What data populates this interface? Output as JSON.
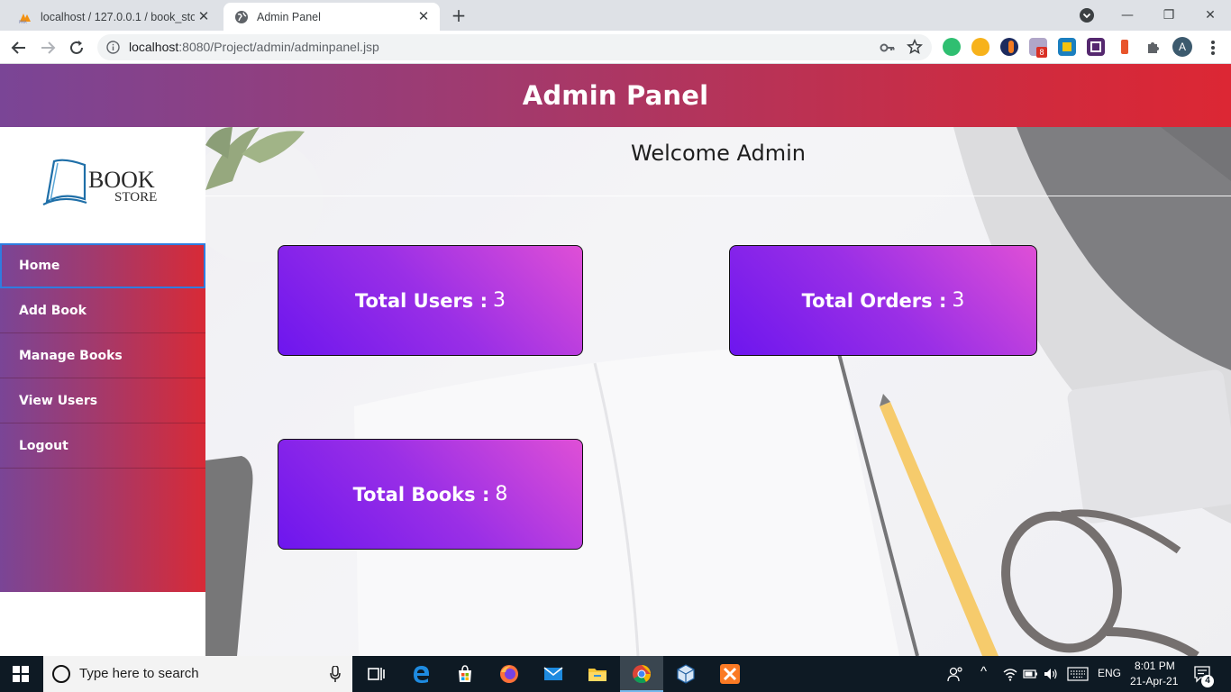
{
  "browser": {
    "tabs": [
      {
        "title": "localhost / 127.0.0.1 / book_store",
        "active": false
      },
      {
        "title": "Admin Panel",
        "active": true
      }
    ],
    "url_host": "localhost",
    "url_rest": ":8080/Project/admin/adminpanel.jsp",
    "profile_initial": "A",
    "extension_badge": "8"
  },
  "page": {
    "header_title": "Admin Panel",
    "welcome": "Welcome Admin",
    "logo": {
      "line1": "BOOK",
      "line2": "STORE"
    },
    "menu": [
      {
        "label": "Home",
        "active": true
      },
      {
        "label": "Add Book",
        "active": false
      },
      {
        "label": "Manage Books",
        "active": false
      },
      {
        "label": "View Users",
        "active": false
      },
      {
        "label": "Logout",
        "active": false
      }
    ],
    "cards": {
      "users": {
        "label": "Total Users :",
        "value": "3"
      },
      "orders": {
        "label": "Total Orders :",
        "value": "3"
      },
      "books": {
        "label": "Total Books :",
        "value": "8"
      }
    }
  },
  "taskbar": {
    "search_placeholder": "Type here to search",
    "language": "ENG",
    "time": "8:01 PM",
    "date": "21-Apr-21",
    "notifications": "4"
  },
  "colors": {
    "header_gradient_start": "#7a4596",
    "header_gradient_end": "#dc2734",
    "card_gradient_start": "#6d16ee",
    "card_gradient_end": "#df4fd6",
    "active_outline": "#2f7ce0"
  }
}
